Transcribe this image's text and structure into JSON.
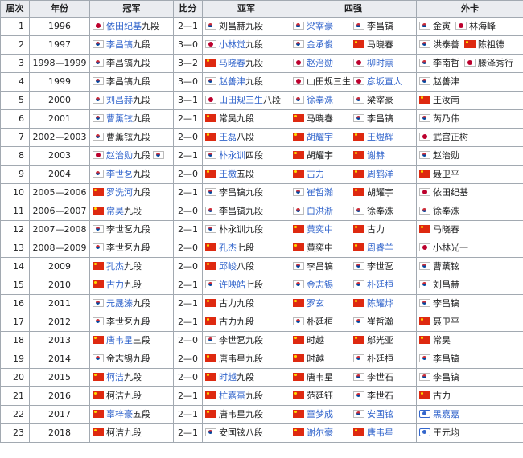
{
  "headers": [
    "届次",
    "年份",
    "冠军",
    "比分",
    "亚军",
    "四强",
    "外卡"
  ],
  "rows": [
    {
      "no": "1",
      "year": "1996",
      "champ": {
        "flag": "jp",
        "name": "依田纪基",
        "rank": "九段",
        "link": true
      },
      "score": "2—1",
      "runner": {
        "flag": "kr",
        "name": "刘昌赫",
        "rank": "九段",
        "link": false
      },
      "semis": [
        {
          "flag": "kr",
          "name": "梁宰豪",
          "link": true
        },
        {
          "flag": "kr",
          "name": "李昌镐",
          "link": false
        }
      ],
      "wild": [
        {
          "flag": "kr",
          "name": "金寅",
          "link": false
        },
        {
          "flag": "jp",
          "name": "林海峰",
          "link": false
        }
      ]
    },
    {
      "no": "2",
      "year": "1997",
      "champ": {
        "flag": "kr",
        "name": "李昌镐",
        "rank": "九段",
        "link": true
      },
      "score": "3—0",
      "runner": {
        "flag": "jp",
        "name": "小林觉",
        "rank": "九段",
        "link": true
      },
      "semis": [
        {
          "flag": "kr",
          "name": "金承俊",
          "link": true
        },
        {
          "flag": "cn",
          "name": "马晓春",
          "link": false
        }
      ],
      "wild": [
        {
          "flag": "kr",
          "name": "洪泰善",
          "link": false
        },
        {
          "flag": "cn",
          "name": "陈祖德",
          "link": false
        }
      ]
    },
    {
      "no": "3",
      "year": "1998—1999",
      "champ": {
        "flag": "kr",
        "name": "李昌镐",
        "rank": "九段",
        "link": false
      },
      "score": "3—2",
      "runner": {
        "flag": "cn",
        "name": "马晓春",
        "rank": "九段",
        "link": true
      },
      "semis": [
        {
          "flag": "jp",
          "name": "赵治勋",
          "link": true
        },
        {
          "flag": "jp",
          "name": "柳时熏",
          "link": true
        }
      ],
      "wild": [
        {
          "flag": "kr",
          "name": "李南哲",
          "link": false
        },
        {
          "flag": "jp",
          "name": "滕泽秀行",
          "link": false
        }
      ]
    },
    {
      "no": "4",
      "year": "1999",
      "champ": {
        "flag": "kr",
        "name": "李昌镐",
        "rank": "九段",
        "link": false
      },
      "score": "3—0",
      "runner": {
        "flag": "kr",
        "name": "赵善津",
        "rank": "九段",
        "link": true
      },
      "semis": [
        {
          "flag": "jp",
          "name": "山田规三生",
          "link": false
        },
        {
          "flag": "jp",
          "name": "彦坂直人",
          "link": true
        }
      ],
      "wild": [
        {
          "flag": "kr",
          "name": "赵善津",
          "link": false
        }
      ]
    },
    {
      "no": "5",
      "year": "2000",
      "champ": {
        "flag": "kr",
        "name": "刘昌赫",
        "rank": "九段",
        "link": true
      },
      "score": "3—1",
      "runner": {
        "flag": "jp",
        "name": "山田规三生",
        "rank": "八段",
        "link": true
      },
      "semis": [
        {
          "flag": "kr",
          "name": "徐奉洙",
          "link": true
        },
        {
          "flag": "kr",
          "name": "梁宰豪",
          "link": false
        }
      ],
      "wild": [
        {
          "flag": "cn",
          "name": "王汝南",
          "link": false
        }
      ]
    },
    {
      "no": "6",
      "year": "2001",
      "champ": {
        "flag": "kr",
        "name": "曹薰铉",
        "rank": "九段",
        "link": true
      },
      "score": "2—1",
      "runner": {
        "flag": "cn",
        "name": "常昊",
        "rank": "九段",
        "link": false
      },
      "semis": [
        {
          "flag": "cn",
          "name": "马晓春",
          "link": false
        },
        {
          "flag": "kr",
          "name": "李昌镐",
          "link": false
        }
      ],
      "wild": [
        {
          "flag": "kr",
          "name": "芮乃伟",
          "link": false
        }
      ]
    },
    {
      "no": "7",
      "year": "2002—2003",
      "champ": {
        "flag": "kr",
        "name": "曹薰铉",
        "rank": "九段",
        "link": false
      },
      "score": "2—0",
      "runner": {
        "flag": "cn",
        "name": "王磊",
        "rank": "八段",
        "link": true
      },
      "semis": [
        {
          "flag": "cn",
          "name": "胡耀宇",
          "link": true
        },
        {
          "flag": "cn",
          "name": "王煜辉",
          "link": true
        }
      ],
      "wild": [
        {
          "flag": "jp",
          "name": "武宫正树",
          "link": false
        }
      ]
    },
    {
      "no": "8",
      "year": "2003",
      "champ": {
        "flag": "jp",
        "name": "赵治勋",
        "rank": "九段",
        "link": true,
        "extra": "kr"
      },
      "score": "2—1",
      "runner": {
        "flag": "kr",
        "name": "朴永训",
        "rank": "四段",
        "link": true
      },
      "semis": [
        {
          "flag": "cn",
          "name": "胡耀宇",
          "link": false
        },
        {
          "flag": "cn",
          "name": "谢赫",
          "link": true
        }
      ],
      "wild": [
        {
          "flag": "kr",
          "name": "赵治勋",
          "link": false
        }
      ]
    },
    {
      "no": "9",
      "year": "2004",
      "champ": {
        "flag": "kr",
        "name": "李世乭",
        "rank": "九段",
        "link": true
      },
      "score": "2—0",
      "runner": {
        "flag": "cn",
        "name": "王檄",
        "rank": "五段",
        "link": true
      },
      "semis": [
        {
          "flag": "cn",
          "name": "古力",
          "link": true
        },
        {
          "flag": "cn",
          "name": "周鹤洋",
          "link": true
        }
      ],
      "wild": [
        {
          "flag": "cn",
          "name": "聂卫平",
          "link": false
        }
      ]
    },
    {
      "no": "10",
      "year": "2005—2006",
      "champ": {
        "flag": "cn",
        "name": "罗洗河",
        "rank": "九段",
        "link": true
      },
      "score": "2—1",
      "runner": {
        "flag": "kr",
        "name": "李昌镐",
        "rank": "九段",
        "link": false
      },
      "semis": [
        {
          "flag": "kr",
          "name": "崔哲瀚",
          "link": true
        },
        {
          "flag": "cn",
          "name": "胡耀宇",
          "link": false
        }
      ],
      "wild": [
        {
          "flag": "jp",
          "name": "依田纪基",
          "link": false
        }
      ]
    },
    {
      "no": "11",
      "year": "2006—2007",
      "champ": {
        "flag": "cn",
        "name": "常昊",
        "rank": "九段",
        "link": true
      },
      "score": "2—0",
      "runner": {
        "flag": "kr",
        "name": "李昌镐",
        "rank": "九段",
        "link": false
      },
      "semis": [
        {
          "flag": "kr",
          "name": "白洪淅",
          "link": true
        },
        {
          "flag": "kr",
          "name": "徐奉洙",
          "link": false
        }
      ],
      "wild": [
        {
          "flag": "kr",
          "name": "徐奉洙",
          "link": false
        }
      ]
    },
    {
      "no": "12",
      "year": "2007—2008",
      "champ": {
        "flag": "kr",
        "name": "李世乭",
        "rank": "九段",
        "link": false
      },
      "score": "2—1",
      "runner": {
        "flag": "kr",
        "name": "朴永训",
        "rank": "九段",
        "link": false
      },
      "semis": [
        {
          "flag": "cn",
          "name": "黄奕中",
          "link": true
        },
        {
          "flag": "cn",
          "name": "古力",
          "link": false
        }
      ],
      "wild": [
        {
          "flag": "cn",
          "name": "马晓春",
          "link": false
        }
      ]
    },
    {
      "no": "13",
      "year": "2008—2009",
      "champ": {
        "flag": "kr",
        "name": "李世乭",
        "rank": "九段",
        "link": false
      },
      "score": "2—0",
      "runner": {
        "flag": "cn",
        "name": "孔杰",
        "rank": "七段",
        "link": true
      },
      "semis": [
        {
          "flag": "cn",
          "name": "黄奕中",
          "link": false
        },
        {
          "flag": "cn",
          "name": "周睿羊",
          "link": true
        }
      ],
      "wild": [
        {
          "flag": "jp",
          "name": "小林光一",
          "link": false
        }
      ]
    },
    {
      "no": "14",
      "year": "2009",
      "champ": {
        "flag": "cn",
        "name": "孔杰",
        "rank": "九段",
        "link": true
      },
      "score": "2—0",
      "runner": {
        "flag": "cn",
        "name": "邱峻",
        "rank": "八段",
        "link": true
      },
      "semis": [
        {
          "flag": "kr",
          "name": "李昌镐",
          "link": false
        },
        {
          "flag": "kr",
          "name": "李世乭",
          "link": false
        }
      ],
      "wild": [
        {
          "flag": "kr",
          "name": "曹薰铉",
          "link": false
        }
      ]
    },
    {
      "no": "15",
      "year": "2010",
      "champ": {
        "flag": "cn",
        "name": "古力",
        "rank": "九段",
        "link": true
      },
      "score": "2—1",
      "runner": {
        "flag": "kr",
        "name": "许映皓",
        "rank": "七段",
        "link": true
      },
      "semis": [
        {
          "flag": "kr",
          "name": "金志锡",
          "link": true
        },
        {
          "flag": "kr",
          "name": "朴廷桓",
          "link": true
        }
      ],
      "wild": [
        {
          "flag": "kr",
          "name": "刘昌赫",
          "link": false
        }
      ]
    },
    {
      "no": "16",
      "year": "2011",
      "champ": {
        "flag": "kr",
        "name": "元晟溱",
        "rank": "九段",
        "link": true
      },
      "score": "2—1",
      "runner": {
        "flag": "cn",
        "name": "古力",
        "rank": "九段",
        "link": false
      },
      "semis": [
        {
          "flag": "cn",
          "name": "罗玄",
          "link": true
        },
        {
          "flag": "cn",
          "name": "陈耀烨",
          "link": true
        }
      ],
      "wild": [
        {
          "flag": "kr",
          "name": "李昌镐",
          "link": false
        }
      ]
    },
    {
      "no": "17",
      "year": "2012",
      "champ": {
        "flag": "kr",
        "name": "李世乭",
        "rank": "九段",
        "link": false
      },
      "score": "2—1",
      "runner": {
        "flag": "cn",
        "name": "古力",
        "rank": "九段",
        "link": false
      },
      "semis": [
        {
          "flag": "kr",
          "name": "朴廷桓",
          "link": false
        },
        {
          "flag": "kr",
          "name": "崔哲瀚",
          "link": false
        }
      ],
      "wild": [
        {
          "flag": "cn",
          "name": "聂卫平",
          "link": false
        }
      ]
    },
    {
      "no": "18",
      "year": "2013",
      "champ": {
        "flag": "cn",
        "name": "唐韦星",
        "rank": "三段",
        "link": true
      },
      "score": "2—0",
      "runner": {
        "flag": "kr",
        "name": "李世乭",
        "rank": "九段",
        "link": false
      },
      "semis": [
        {
          "flag": "cn",
          "name": "时越",
          "link": false
        },
        {
          "flag": "cn",
          "name": "鄔光亚",
          "link": false
        }
      ],
      "wild": [
        {
          "flag": "cn",
          "name": "常昊",
          "link": false
        }
      ]
    },
    {
      "no": "19",
      "year": "2014",
      "champ": {
        "flag": "kr",
        "name": "金志锡",
        "rank": "九段",
        "link": false
      },
      "score": "2—0",
      "runner": {
        "flag": "cn",
        "name": "唐韦星",
        "rank": "九段",
        "link": false
      },
      "semis": [
        {
          "flag": "cn",
          "name": "时越",
          "link": false
        },
        {
          "flag": "kr",
          "name": "朴廷桓",
          "link": false
        }
      ],
      "wild": [
        {
          "flag": "kr",
          "name": "李昌镐",
          "link": false
        }
      ]
    },
    {
      "no": "20",
      "year": "2015",
      "champ": {
        "flag": "cn",
        "name": "柯洁",
        "rank": "九段",
        "link": true
      },
      "score": "2—0",
      "runner": {
        "flag": "cn",
        "name": "时越",
        "rank": "九段",
        "link": true
      },
      "semis": [
        {
          "flag": "cn",
          "name": "唐韦星",
          "link": false
        },
        {
          "flag": "kr",
          "name": "李世石",
          "link": false
        }
      ],
      "wild": [
        {
          "flag": "kr",
          "name": "李昌镐",
          "link": false
        }
      ]
    },
    {
      "no": "21",
      "year": "2016",
      "champ": {
        "flag": "cn",
        "name": "柯洁",
        "rank": "九段",
        "link": false
      },
      "score": "2—1",
      "runner": {
        "flag": "cn",
        "name": "杧嘉熹",
        "rank": "九段",
        "link": true
      },
      "semis": [
        {
          "flag": "cn",
          "name": "范廷钰",
          "link": false
        },
        {
          "flag": "kr",
          "name": "李世石",
          "link": false
        }
      ],
      "wild": [
        {
          "flag": "cn",
          "name": "古力",
          "link": false
        }
      ]
    },
    {
      "no": "22",
      "year": "2017",
      "champ": {
        "flag": "cn",
        "name": "辜梓豪",
        "rank": "五段",
        "link": true
      },
      "score": "2—1",
      "runner": {
        "flag": "cn",
        "name": "唐韦星",
        "rank": "九段",
        "link": false
      },
      "semis": [
        {
          "flag": "cn",
          "name": "童梦成",
          "link": true
        },
        {
          "flag": "kr",
          "name": "安国铉",
          "link": true
        }
      ],
      "wild": [
        {
          "flag": "tw",
          "name": "黑嘉嘉",
          "link": true
        }
      ]
    },
    {
      "no": "23",
      "year": "2018",
      "champ": {
        "flag": "cn",
        "name": "柯洁",
        "rank": "九段",
        "link": false
      },
      "score": "2—1",
      "runner": {
        "flag": "kr",
        "name": "安国铉",
        "rank": "八段",
        "link": false
      },
      "semis": [
        {
          "flag": "cn",
          "name": "谢尔豪",
          "link": true
        },
        {
          "flag": "cn",
          "name": "唐韦星",
          "link": true
        }
      ],
      "wild": [
        {
          "flag": "tw",
          "name": "王元均",
          "link": false
        }
      ]
    }
  ]
}
